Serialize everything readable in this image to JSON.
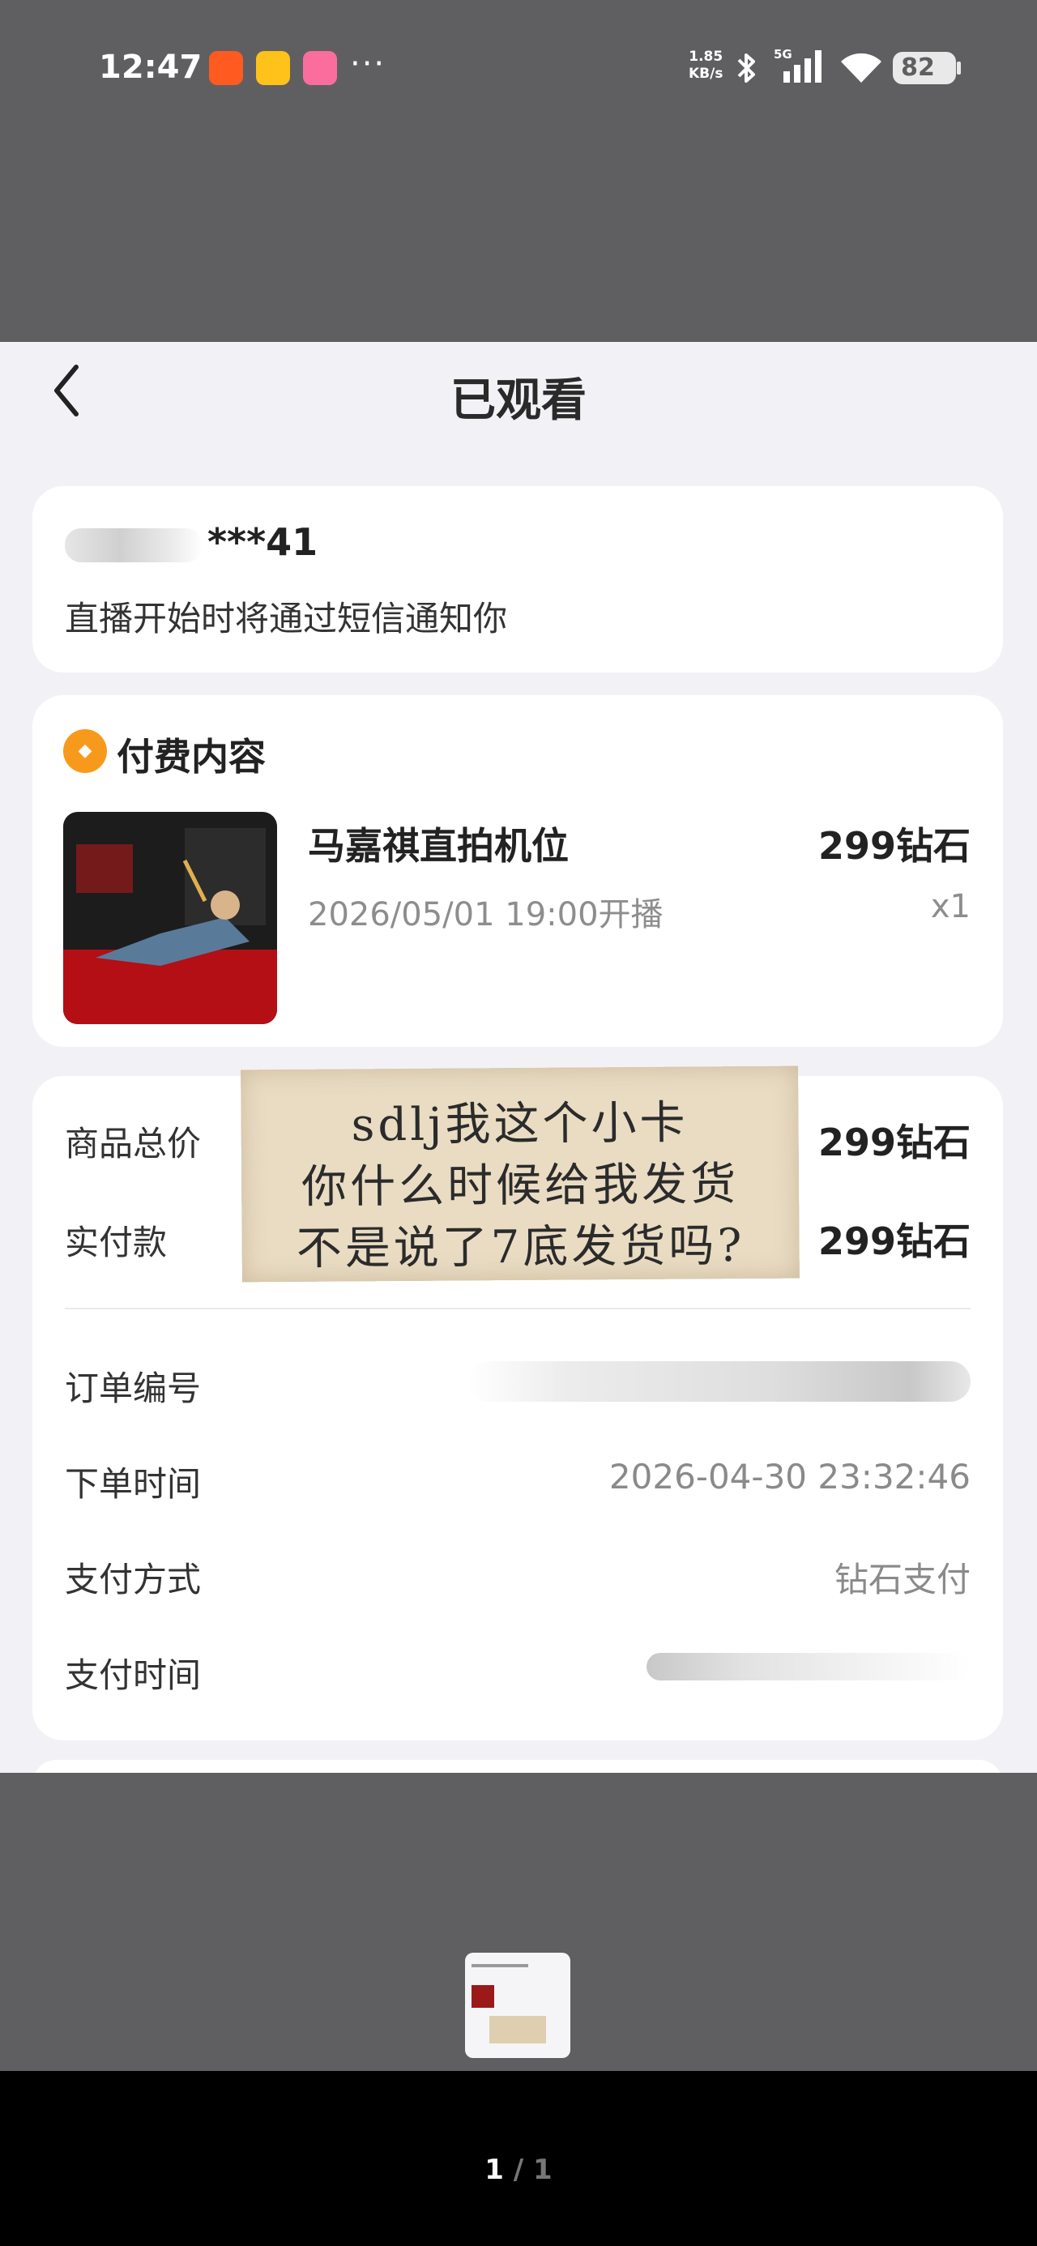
{
  "status_bar": {
    "time": "12:47",
    "app_icons": [
      "kuaishou-icon",
      "weibo-icon",
      "bilibili-icon"
    ],
    "more": "···",
    "net_speed_value": "1.85",
    "net_speed_unit": "KB/s",
    "network": "5G",
    "battery": "82"
  },
  "nav": {
    "title": "已观看"
  },
  "contact": {
    "phone_visible": "***41",
    "notice": "直播开始时将通过短信通知你"
  },
  "paid": {
    "section_title": "付费内容",
    "product_name": "马嘉祺直拍机位",
    "start_time": "2026/05/01 19:00开播",
    "price": "299钻石",
    "quantity": "x1"
  },
  "order": {
    "total_label": "商品总价",
    "total_value": "299钻石",
    "paid_label": "实付款",
    "paid_value": "299钻石",
    "order_no_label": "订单编号",
    "order_time_label": "下单时间",
    "order_time_value": "2026-04-30 23:32:46",
    "pay_method_label": "支付方式",
    "pay_method_value": "钻石支付",
    "pay_time_label": "支付时间"
  },
  "note": {
    "line1": "sdlj我这个小卡",
    "line2": "你什么时候给我发货",
    "line3": "不是说了7底发货吗?"
  },
  "viewer": {
    "current": "1",
    "separator": "/",
    "total": "1"
  }
}
